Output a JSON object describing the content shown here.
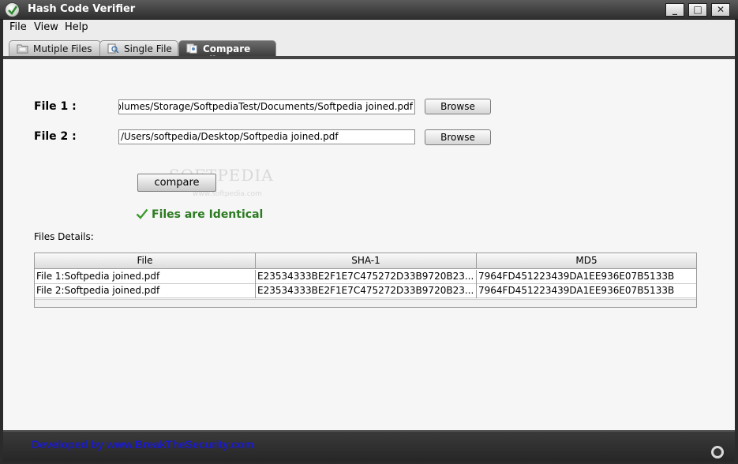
{
  "window": {
    "title": "Hash Code Verifier"
  },
  "menu": {
    "file": "File",
    "view": "View",
    "help": "Help"
  },
  "tabs": [
    {
      "label": "Mutiple Files"
    },
    {
      "label": "Single File"
    },
    {
      "label": "Compare Files",
      "active": true
    }
  ],
  "compare": {
    "file1_label": "File 1 :",
    "file1_value": "/Volumes/Storage/SoftpediaTest/Documents/Softpedia joined.pdf",
    "file2_label": "File 2 :",
    "file2_value": "/Users/softpedia/Desktop/Softpedia joined.pdf",
    "browse_label": "Browse",
    "compare_label": "compare",
    "status_text": "Files are Identical",
    "status_color": "#2c7a22"
  },
  "watermark": {
    "text": "SOFTPEDIA",
    "sub": "www.softpedia.com"
  },
  "details": {
    "label": "Files Details:",
    "columns": [
      "File",
      "SHA-1",
      "MD5"
    ],
    "rows": [
      [
        "File 1:Softpedia joined.pdf",
        "E23534333BE2F1E7C475272D33B9720B23...",
        "7964FD451223439DA1EE936E07B5133B"
      ],
      [
        "File 2:Softpedia joined.pdf",
        "E23534333BE2F1E7C475272D33B9720B23...",
        "7964FD451223439DA1EE936E07B5133B"
      ]
    ]
  },
  "footer": {
    "text": "Developed by www.BreakTheSecurity.com",
    "text_color": "#1a1acc"
  },
  "icons": [
    "app-check-icon",
    "folder-icon",
    "magnifier-icon",
    "compare-icon",
    "check-icon",
    "status-circle-icon"
  ]
}
